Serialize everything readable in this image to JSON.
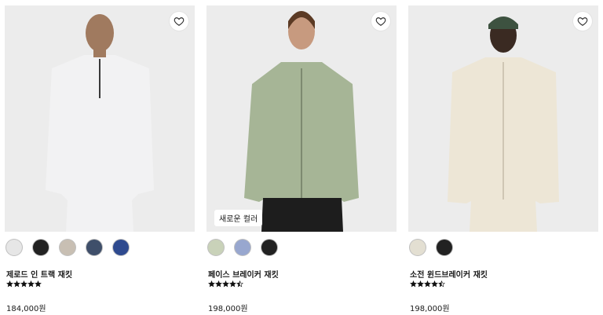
{
  "products": [
    {
      "name": "제로드 인 트랙 재킷",
      "price": "184,000원",
      "badge": "",
      "rating": 5,
      "colors": [
        "#e6e6e6",
        "#222222",
        "#c8bfb3",
        "#3f4f6a",
        "#2e4a8f"
      ],
      "jacket_color": "#f2f2f3",
      "pants_color": "#f2f2f3"
    },
    {
      "name": "페이스 브레이커 재킷",
      "price": "198,000원",
      "badge": "새로운 컬러",
      "rating": 4.5,
      "colors": [
        "#c9d2b9",
        "#98a7cf",
        "#222222"
      ],
      "jacket_color": "#a6b596",
      "pants_color": "#1d1d1d"
    },
    {
      "name": "소전 윈드브레이커 재킷",
      "price": "198,000원",
      "badge": "",
      "rating": 4.5,
      "colors": [
        "#e3dfd2",
        "#222222"
      ],
      "jacket_color": "#ede6d6",
      "pants_color": "#ede6d6"
    }
  ]
}
